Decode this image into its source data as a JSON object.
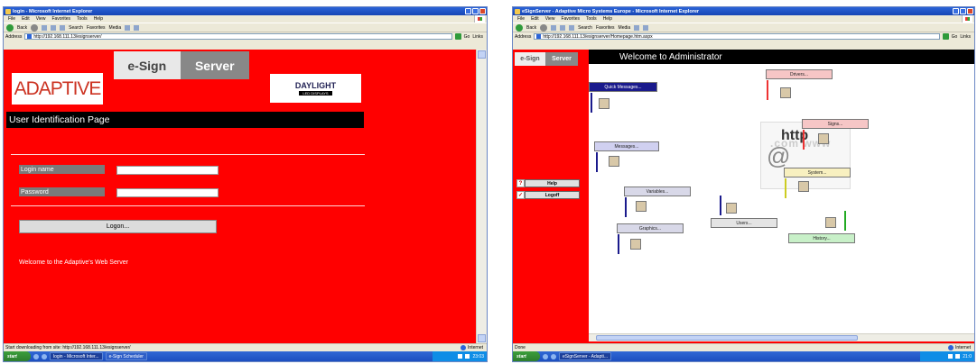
{
  "left": {
    "title": "login - Microsoft Internet Explorer",
    "menu": [
      "File",
      "Edit",
      "View",
      "Favorites",
      "Tools",
      "Help"
    ],
    "toolbar": {
      "back": "Back",
      "search": "Search",
      "favorites": "Favorites",
      "media": "Media"
    },
    "address_label": "Address",
    "address": "http://192.168.111.13/esignserver/",
    "go": "Go",
    "links": "Links",
    "esign_left": "e-Sign",
    "esign_right": "Server",
    "adaptive_logo": "ADAPTIVE",
    "daylight_logo": "DAYLIGHT",
    "daylight_sub": "LED DISPLAYS",
    "page_title": "User Identification Page",
    "login_label": "Login name",
    "password_label": "Password",
    "logon_button": "Logon...",
    "welcome": "Welcome to the Adaptive's Web Server",
    "status": "Start downloading from site: http://192.168.111.13/esignserver/",
    "zone": "Internet",
    "start": "start",
    "taskbar": [
      "login - Microsoft Inter...",
      "e-Sign Scheduler"
    ],
    "clock": "23:03"
  },
  "right": {
    "title": "eSignServer - Adaptive Micro Systems Europe - Microsoft Internet Explorer",
    "menu": [
      "File",
      "Edit",
      "View",
      "Favorites",
      "Tools",
      "Help"
    ],
    "toolbar": {
      "back": "Back",
      "search": "Search",
      "favorites": "Favorites",
      "media": "Media"
    },
    "address_label": "Address",
    "address": "http://192.168.111.13/esignserver/Homepage.htm.aspx",
    "go": "Go",
    "links": "Links",
    "esign_left": "e-Sign",
    "esign_right": "Server",
    "header": "Welcome to Administrator",
    "help": "Help",
    "logoff": "Logoff",
    "buttons": {
      "quick": "Quick Messages...",
      "drivers": "Drivers...",
      "signs": "Signs...",
      "messages": "Messages...",
      "system": "System...",
      "variables": "Variables...",
      "users": "Users...",
      "graphics": "Graphics...",
      "history": "History..."
    },
    "http": "http",
    "www": ".com www",
    "status": "Done",
    "zone": "Internet",
    "start": "start",
    "taskbar": [
      "eSignServer - Adapti..."
    ],
    "clock": "21:0"
  },
  "colors": {
    "page_red": "#ff0000",
    "header_black": "#000000"
  }
}
